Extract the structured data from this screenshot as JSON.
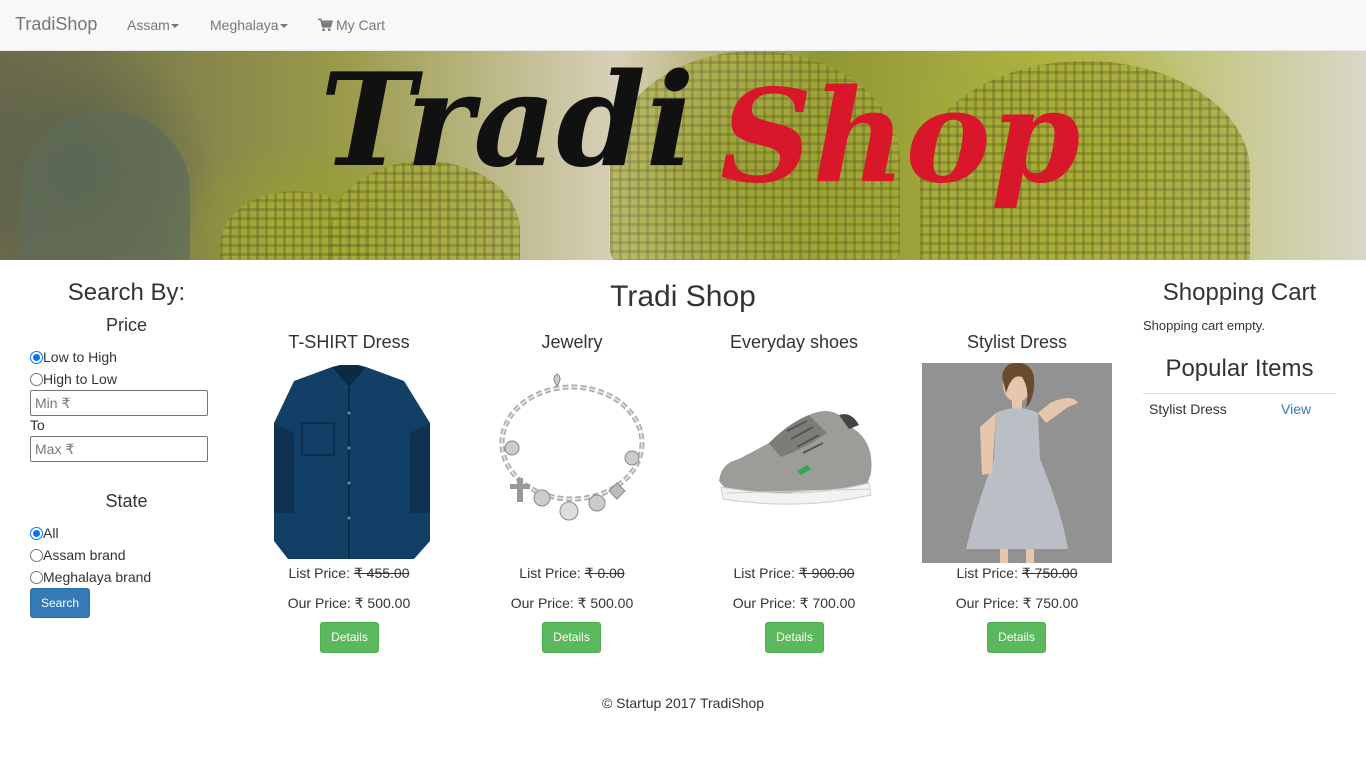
{
  "navbar": {
    "brand": "TradiShop",
    "items": [
      {
        "label": "Assam"
      },
      {
        "label": "Meghalaya"
      },
      {
        "label": "My Cart"
      }
    ]
  },
  "banner": {
    "logo_part1": "Tradi",
    "logo_part2": "Shop",
    "logo_colors": {
      "part1": "#111111",
      "part2": "#d8182a"
    }
  },
  "sidebar": {
    "title": "Search By:",
    "price_heading": "Price",
    "price_options": [
      {
        "label": "Low to High",
        "checked": true
      },
      {
        "label": "High to Low",
        "checked": false
      }
    ],
    "min_placeholder": "Min ₹",
    "to_label": "To",
    "max_placeholder": "Max ₹",
    "state_heading": "State",
    "state_options": [
      {
        "label": "All",
        "checked": true
      },
      {
        "label": "Assam brand",
        "checked": false
      },
      {
        "label": "Meghalaya brand",
        "checked": false
      }
    ],
    "search_button": "Search"
  },
  "main": {
    "title": "Tradi Shop",
    "products": [
      {
        "name": "T-SHIRT Dress",
        "list_label": "List Price: ",
        "list_price": "₹ 455.00",
        "our_price": "Our Price: ₹ 500.00",
        "button": "Details",
        "image": "shirt-image"
      },
      {
        "name": "Jewelry",
        "list_label": "List Price: ",
        "list_price": "₹ 0.00",
        "our_price": "Our Price: ₹ 500.00",
        "button": "Details",
        "image": "bracelet-image"
      },
      {
        "name": "Everyday shoes",
        "list_label": "List Price: ",
        "list_price": "₹ 900.00",
        "our_price": "Our Price: ₹ 700.00",
        "button": "Details",
        "image": "shoe-image"
      },
      {
        "name": "Stylist Dress",
        "list_label": "List Price: ",
        "list_price": "₹ 750.00",
        "our_price": "Our Price: ₹ 750.00",
        "button": "Details",
        "image": "dress-image"
      }
    ]
  },
  "cart": {
    "title": "Shopping Cart",
    "empty_text": "Shopping cart empty.",
    "popular_title": "Popular Items",
    "popular_items": [
      {
        "name": "Stylist Dress",
        "action": "View"
      }
    ]
  },
  "footer": {
    "text": "© Startup 2017 TradiShop"
  },
  "colors": {
    "primary": "#337ab7",
    "success": "#5cb85c",
    "navbar_bg": "#f8f8f8"
  }
}
